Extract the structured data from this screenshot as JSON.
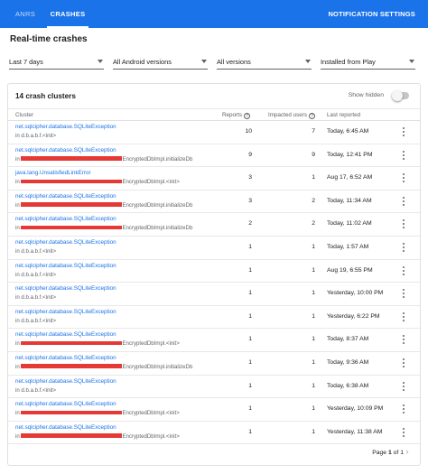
{
  "tabs": [
    {
      "label": "ANRS"
    },
    {
      "label": "CRASHES"
    }
  ],
  "notification_settings": "NOTIFICATION SETTINGS",
  "page_title": "Real-time crashes",
  "filters": {
    "period": "Last 7 days",
    "android": "All Android versions",
    "versions": "All versions",
    "source": "Installed from Play"
  },
  "card": {
    "title": "14 crash clusters",
    "show_hidden": "Show hidden",
    "show_hidden_on": false
  },
  "columns": {
    "cluster": "Cluster",
    "reports": "Reports",
    "impacted": "Impacted users",
    "last": "Last reported",
    "help_icon": "?"
  },
  "rows": [
    {
      "exception": "net.sqlcipher.database.SQLiteException",
      "location": "in d.b.a.b.f.<init>",
      "redacted": false,
      "suffix": "",
      "reports": "10",
      "impacted": "7",
      "last": "Today, 6:45 AM"
    },
    {
      "exception": "net.sqlcipher.database.SQLiteException",
      "location": "in",
      "redacted": true,
      "suffix": "EncryptedDbImpl.initializeDb",
      "reports": "9",
      "impacted": "9",
      "last": "Today, 12:41 PM"
    },
    {
      "exception": "java.lang.UnsatisfiedLinkError",
      "location": "in",
      "redacted": true,
      "suffix": "EncryptedDbImpl.<init>",
      "reports": "3",
      "impacted": "1",
      "last": "Aug 17, 6:52 AM"
    },
    {
      "exception": "net.sqlcipher.database.SQLiteException",
      "location": "in",
      "redacted": true,
      "suffix": "EncryptedDbImpl.initializeDb",
      "reports": "3",
      "impacted": "2",
      "last": "Today, 11:34 AM"
    },
    {
      "exception": "net.sqlcipher.database.SQLiteException",
      "location": "in",
      "redacted": true,
      "suffix": "EncryptedDbImpl.initializeDb",
      "reports": "2",
      "impacted": "2",
      "last": "Today, 11:02 AM"
    },
    {
      "exception": "net.sqlcipher.database.SQLiteException",
      "location": "in d.b.a.b.f.<init>",
      "redacted": false,
      "suffix": "",
      "reports": "1",
      "impacted": "1",
      "last": "Today, 1:57 AM"
    },
    {
      "exception": "net.sqlcipher.database.SQLiteException",
      "location": "in d.b.a.b.f.<init>",
      "redacted": false,
      "suffix": "",
      "reports": "1",
      "impacted": "1",
      "last": "Aug 19, 6:55 PM"
    },
    {
      "exception": "net.sqlcipher.database.SQLiteException",
      "location": "in d.b.a.b.f.<init>",
      "redacted": false,
      "suffix": "",
      "reports": "1",
      "impacted": "1",
      "last": "Yesterday, 10:00 PM"
    },
    {
      "exception": "net.sqlcipher.database.SQLiteException",
      "location": "in d.b.a.b.f.<init>",
      "redacted": false,
      "suffix": "",
      "reports": "1",
      "impacted": "1",
      "last": "Yesterday, 6:22 PM"
    },
    {
      "exception": "net.sqlcipher.database.SQLiteException",
      "location": "in",
      "redacted": true,
      "suffix": "EncryptedDbImpl.<init>",
      "reports": "1",
      "impacted": "1",
      "last": "Today, 8:37 AM"
    },
    {
      "exception": "net.sqlcipher.database.SQLiteException",
      "location": "in",
      "redacted": true,
      "suffix": "EncryptedDbImpl.initializeDb",
      "reports": "1",
      "impacted": "1",
      "last": "Today, 9:36 AM"
    },
    {
      "exception": "net.sqlcipher.database.SQLiteException",
      "location": "in d.b.a.b.f.<init>",
      "redacted": false,
      "suffix": "",
      "reports": "1",
      "impacted": "1",
      "last": "Today, 6:38 AM"
    },
    {
      "exception": "net.sqlcipher.database.SQLiteException",
      "location": "in",
      "redacted": true,
      "suffix": "EncryptedDbImpl.<init>",
      "reports": "1",
      "impacted": "1",
      "last": "Yesterday, 10:09 PM"
    },
    {
      "exception": "net.sqlcipher.database.SQLiteException",
      "location": "in",
      "redacted": true,
      "suffix": "EncryptedDbImpl.<init>",
      "reports": "1",
      "impacted": "1",
      "last": "Yesterday, 11:38 AM"
    }
  ],
  "pager": {
    "prefix": "Page",
    "page": "1",
    "of": "of 1"
  },
  "icons": {
    "dropdown": "chevron-down-icon",
    "row_menu": "more-vert-icon",
    "prev": "chevron-left-icon",
    "next": "chevron-right-icon"
  },
  "colors": {
    "accent": "#1a73e8",
    "redaction": "#e53935"
  }
}
